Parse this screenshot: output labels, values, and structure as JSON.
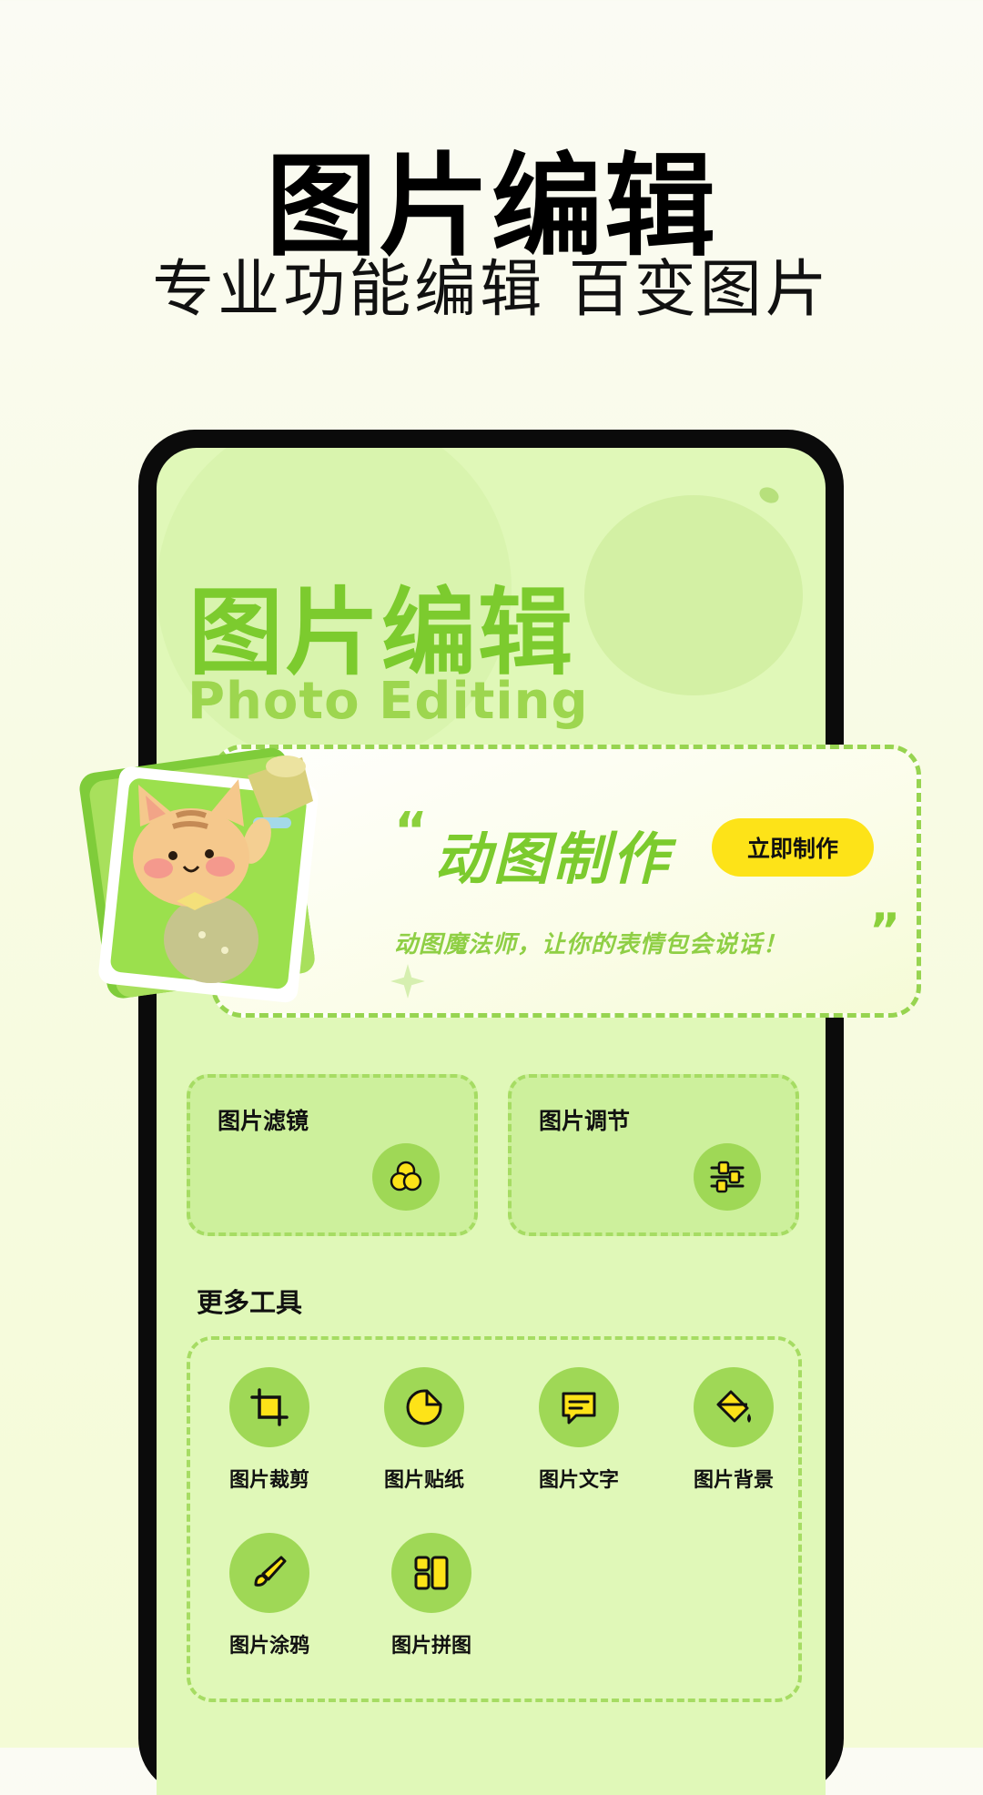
{
  "promo": {
    "title": "图片编辑",
    "subtitle": "专业功能编辑 百变图片"
  },
  "screen": {
    "title": "图片编辑",
    "subtitle": "Photo Editing"
  },
  "gif_banner": {
    "quote_open": "“",
    "title": "动图制作",
    "button": "立即制作",
    "description": "动图魔法师，让你的表情包会说话！",
    "quote_close": "”"
  },
  "features": [
    {
      "label": "图片滤镜",
      "icon": "filter-circles-icon"
    },
    {
      "label": "图片调节",
      "icon": "sliders-icon"
    }
  ],
  "more_tools": {
    "title": "更多工具",
    "items": [
      {
        "label": "图片裁剪",
        "icon": "crop-icon"
      },
      {
        "label": "图片贴纸",
        "icon": "sticker-icon"
      },
      {
        "label": "图片文字",
        "icon": "text-bubble-icon"
      },
      {
        "label": "图片背景",
        "icon": "paint-bucket-icon"
      },
      {
        "label": "图片涂鸦",
        "icon": "brush-icon"
      },
      {
        "label": "图片拼图",
        "icon": "collage-icon"
      }
    ]
  },
  "colors": {
    "accent_green": "#7ccb2e",
    "icon_yellow": "#fde318",
    "screen_bg": "#e0f8b8"
  }
}
